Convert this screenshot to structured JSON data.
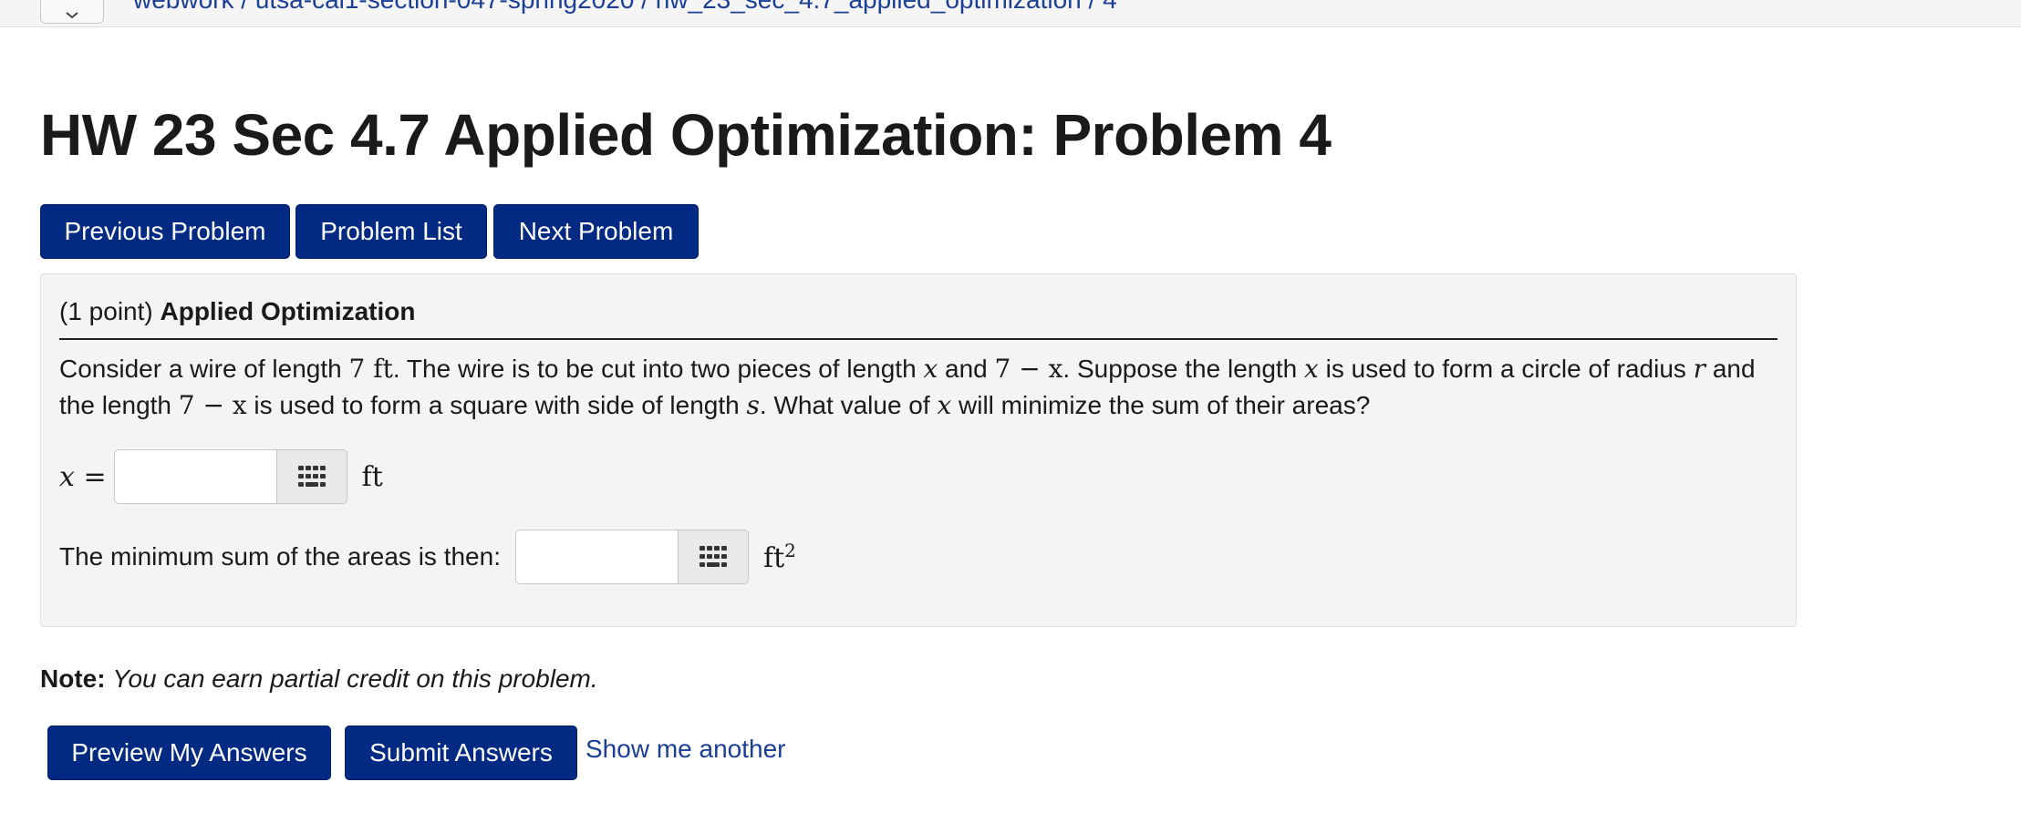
{
  "breadcrumb": "webwork / utsa-cal1-section-047-spring2020 / hw_23_sec_4.7_applied_optimization / 4",
  "page_title": "HW 23 Sec 4.7 Applied Optimization: Problem 4",
  "nav": {
    "previous": "Previous Problem",
    "list": "Problem List",
    "next": "Next Problem"
  },
  "problem": {
    "points": "(1 point)",
    "heading": "Applied Optimization",
    "text": {
      "t1": "Consider a wire of length ",
      "wire_length": "7 ft",
      "t2": ". The wire is to be cut into two pieces of length ",
      "var_x": "x",
      "t3": " and ",
      "seven_minus_x": "7 − x",
      "t4": ". Suppose the length ",
      "t5": " is used to form a circle of radius ",
      "var_r": "r",
      "t6": " and the length ",
      "t7": " is used to form a square with side of length ",
      "var_s": "s",
      "t8": ". What value of ",
      "t9": " will minimize the sum of their areas?"
    },
    "answer1": {
      "label": "x =",
      "value": "",
      "unit": "ft"
    },
    "answer2": {
      "label": "The minimum sum of the areas is then:",
      "value": "",
      "unit": "ft",
      "unit_exp": "2"
    }
  },
  "note": {
    "label": "Note:",
    "text": "You can earn partial credit on this problem."
  },
  "actions": {
    "preview": "Preview My Answers",
    "submit": "Submit Answers",
    "another": "Show me another"
  },
  "colors": {
    "button_bg": "#022a83",
    "link": "#1b3f94",
    "panel_bg": "#f4f4f4"
  }
}
